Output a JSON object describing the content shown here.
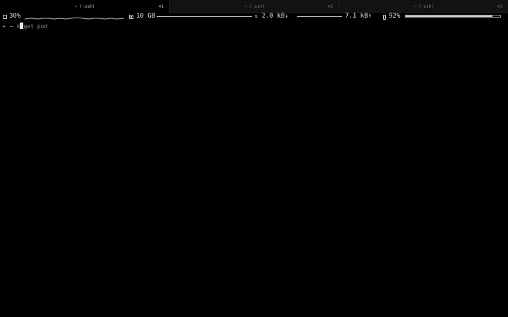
{
  "tabs": [
    {
      "title": "~ (-zsh)",
      "shortcut": "⌘1",
      "active": true
    },
    {
      "title": "~ (-zsh)",
      "shortcut": "⌘2",
      "active": false
    },
    {
      "title": "~ (-zsh)",
      "shortcut": "⌘3",
      "active": false
    }
  ],
  "status": {
    "cpu_label": "30%",
    "memory_label": "10 GB",
    "net_down_label": "2.0 kB↓",
    "net_up_label": "7.1 kB↑",
    "battery_label": "92%",
    "battery_level": 0.92
  },
  "terminal": {
    "prompt_arrow": "➜",
    "prompt_dir": "~",
    "typed_before_cursor": "k",
    "typed_after_cursor": "get pod"
  },
  "colors": {
    "background": "#000000",
    "tab_bar": "#121212",
    "text": "#d8d8d8"
  }
}
